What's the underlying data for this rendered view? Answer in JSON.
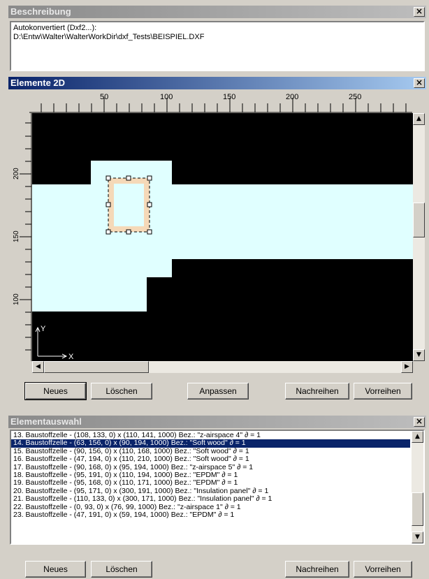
{
  "beschreibung": {
    "title": "Beschreibung",
    "text_line1": "Autokonvertiert (Dxf2...):",
    "text_line2": "D:\\Entw\\Walter\\WalterWorkDir\\dxf_Tests\\BEISPIEL.DXF"
  },
  "elemente": {
    "title": "Elemente 2D",
    "ruler_top": [
      "50",
      "100",
      "150",
      "200",
      "250"
    ],
    "ruler_left": [
      "200",
      "150",
      "100"
    ],
    "axis_y": "Y",
    "axis_x": "X",
    "buttons": {
      "neues": "Neues",
      "loeschen": "Löschen",
      "anpassen": "Anpassen",
      "nachreihen": "Nachreihen",
      "vorreihen": "Vorreihen"
    },
    "colors": {
      "background": "#000000",
      "insulation": "#e0ffff",
      "wood": "#f5d9b8"
    }
  },
  "auswahl": {
    "title": "Elementauswahl",
    "selected_index": 1,
    "items": [
      "13. Baustoffzelle - (108, 133, 0) x (110, 141, 1000) Bez.: \"z-airspace 4\" ∂ = 1",
      "14. Baustoffzelle - (63, 156, 0) x (90, 194, 1000) Bez.: \"Soft wood\" ∂ = 1",
      "15. Baustoffzelle - (90, 156, 0) x (110, 168, 1000) Bez.: \"Soft wood\" ∂ = 1",
      "16. Baustoffzelle - (47, 194, 0) x (110, 210, 1000) Bez.: \"Soft wood\" ∂ = 1",
      "17. Baustoffzelle - (90, 168, 0) x (95, 194, 1000) Bez.: \"z-airspace 5\" ∂ = 1",
      "18. Baustoffzelle - (95, 191, 0) x (110, 194, 1000) Bez.: \"EPDM\" ∂ = 1",
      "19. Baustoffzelle - (95, 168, 0) x (110, 171, 1000) Bez.: \"EPDM\" ∂ = 1",
      "20. Baustoffzelle - (95, 171, 0) x (300, 191, 1000) Bez.: \"Insulation panel\" ∂ = 1",
      "21. Baustoffzelle - (110, 133, 0) x (300, 171, 1000) Bez.: \"Insulation panel\" ∂ = 1",
      "22. Baustoffzelle - (0, 93, 0) x (76, 99, 1000) Bez.: \"z-airspace 1\" ∂ = 1",
      "23. Baustoffzelle - (47, 191, 0) x (59, 194, 1000) Bez.: \"EPDM\" ∂ = 1"
    ],
    "buttons": {
      "neues": "Neues",
      "loeschen": "Löschen",
      "nachreihen": "Nachreihen",
      "vorreihen": "Vorreihen"
    }
  }
}
